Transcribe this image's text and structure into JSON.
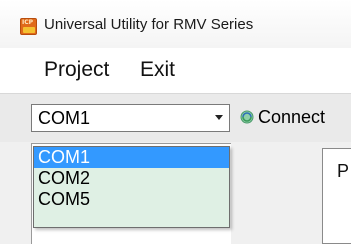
{
  "window": {
    "title": "Universal Utility for RMV Series"
  },
  "menu": {
    "items": [
      {
        "label": "Project"
      },
      {
        "label": "Exit"
      }
    ]
  },
  "toolbar": {
    "port_combo": {
      "value": "COM1",
      "options": [
        "COM1",
        "COM2",
        "COM5"
      ],
      "selected_index": 0
    },
    "connect_label": "Connect"
  },
  "panel": {
    "tab_label": "P"
  },
  "colors": {
    "highlight": "#3399ff",
    "dropdown_bg": "#dff0e4"
  },
  "icons": {
    "app": "app-logo-icon",
    "connect": "connect-icon",
    "dropdown": "chevron-down-icon"
  }
}
